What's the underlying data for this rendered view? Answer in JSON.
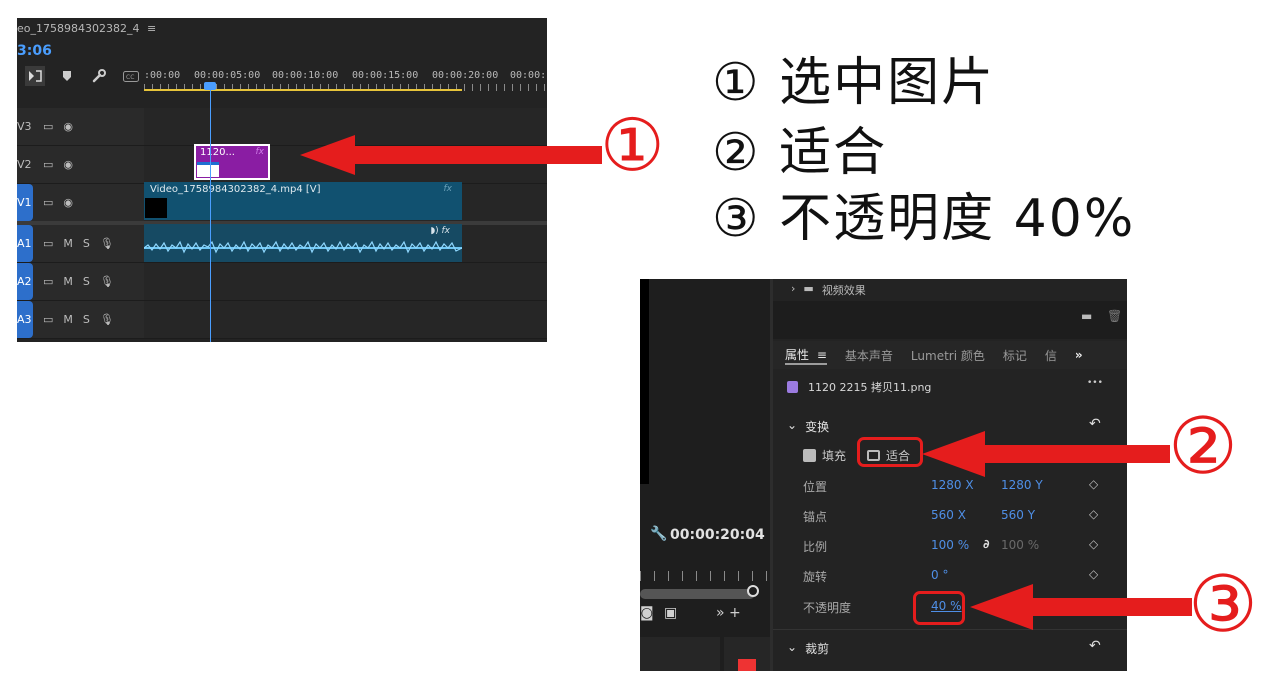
{
  "timeline": {
    "sequence_name": "eo_1758984302382_4",
    "menu_glyph": "≡",
    "timecode": "3:06",
    "ruler_labels": [
      ":00:00",
      "00:00:05:00",
      "00:00:10:00",
      "00:00:15:00",
      "00:00:20:00",
      "00:00:"
    ],
    "tracks": [
      {
        "label": "V3",
        "type": "video"
      },
      {
        "label": "V2",
        "type": "video"
      },
      {
        "label": "V1",
        "type": "video",
        "active": true
      },
      {
        "label": "A1",
        "type": "audio",
        "active": true
      },
      {
        "label": "A2",
        "type": "audio",
        "active": true
      },
      {
        "label": "A3",
        "type": "audio",
        "active": true
      }
    ],
    "audio_btn_m": "M",
    "audio_btn_s": "S",
    "clip_v2_label": "1120...",
    "clip_v1_label": "Video_1758984302382_4.mp4 [V]",
    "fx_label": "fx"
  },
  "steps": [
    {
      "num": "①",
      "text": "选中图片"
    },
    {
      "num": "②",
      "text": "适合"
    },
    {
      "num": "③",
      "text": "不透明度 40%"
    }
  ],
  "callouts": [
    "①",
    "②",
    "③"
  ],
  "left_panel": {
    "timecode": "00:00:20:04"
  },
  "effects": {
    "folder_label": "视频效果"
  },
  "tabs": [
    {
      "label": "属性",
      "active": true
    },
    {
      "label": "基本声音"
    },
    {
      "label": "Lumetri 颜色"
    },
    {
      "label": "标记"
    },
    {
      "label": "信"
    }
  ],
  "tab_menu_glyph": "≡",
  "tab_overflow": "»",
  "clip_name": "1120 2215 拷贝11.png",
  "more_glyph": "•••",
  "transform": {
    "header": "变换",
    "fill_label": "填充",
    "fit_label": "适合",
    "rows": [
      {
        "name": "位置",
        "v1": "1280 X",
        "v2": "1280 Y"
      },
      {
        "name": "锚点",
        "v1": "560 X",
        "v2": "560 Y"
      },
      {
        "name": "比例",
        "v1": "100 %",
        "v2": "100 %"
      },
      {
        "name": "旋转",
        "v1": "0 °",
        "v2": ""
      }
    ],
    "opacity_name": "不透明度",
    "opacity_value": "40 %"
  },
  "crop": {
    "header": "裁剪"
  },
  "colors": {
    "accent_blue": "#4a9eff",
    "clip_purple": "#8a1da3",
    "clip_teal": "#115170",
    "annotation_red": "#e51d1d"
  }
}
